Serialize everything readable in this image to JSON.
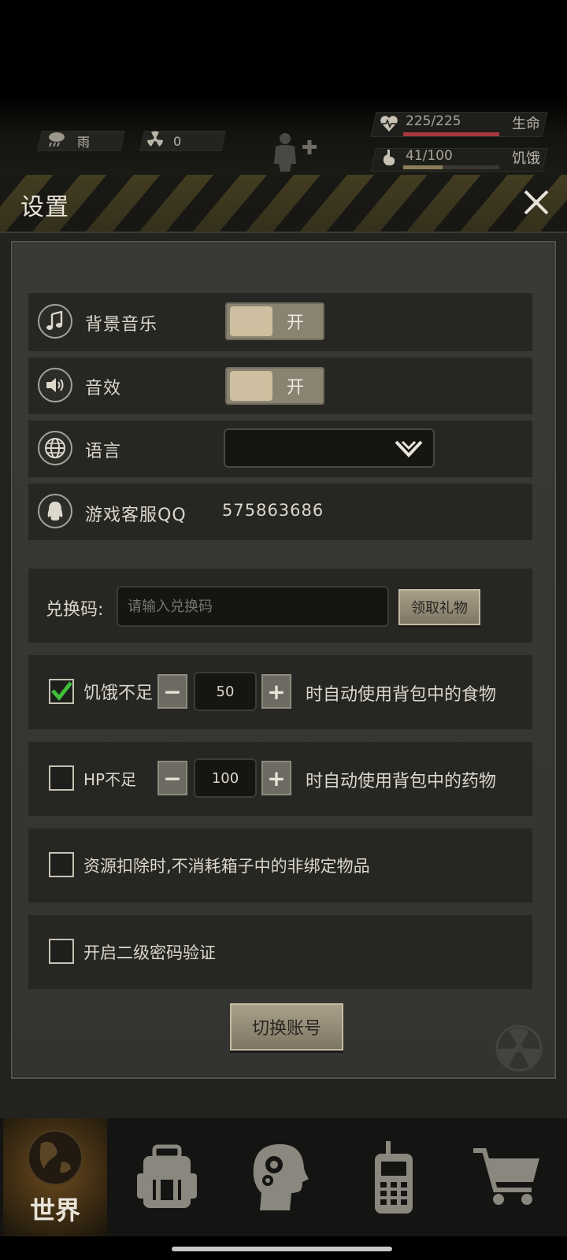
{
  "hud": {
    "weather_label": "雨",
    "weather_icon": "rain-cloud-icon",
    "radiation_value": "0",
    "radiation_icon": "radiation-icon",
    "health_text": "225/225",
    "health_label": "生命",
    "health_fraction": 1.0,
    "hunger_text": "41/100",
    "hunger_label": "饥饿",
    "hunger_fraction": 0.41,
    "colors": {
      "health_bar": "#a8383a",
      "hunger_bar": "#8a7e5a"
    }
  },
  "panel": {
    "title": "设置",
    "close_icon": "close-icon"
  },
  "settings": {
    "bgm_label": "背景音乐",
    "bgm_toggle": "开",
    "sfx_label": "音效",
    "sfx_toggle": "开",
    "language_label": "语言",
    "language_value": "",
    "support_label": "游戏客服QQ",
    "support_qq": "575863686"
  },
  "redeem": {
    "label": "兑换码:",
    "placeholder": "请输入兑换码",
    "button": "领取礼物"
  },
  "auto_food": {
    "checked": true,
    "label": "饥饿不足",
    "value": "50",
    "suffix": "时自动使用背包中的食物"
  },
  "auto_medicine": {
    "checked": false,
    "label": "HP不足",
    "value": "100",
    "suffix": "时自动使用背包中的药物"
  },
  "options": {
    "no_consume_label": "资源扣除时,不消耗箱子中的非绑定物品",
    "second_password_label": "开启二级密码验证"
  },
  "switch_account": "切换账号",
  "bottom_nav": {
    "world_label": "世界",
    "items": [
      "world-globe-icon",
      "backpack-icon",
      "skills-head-icon",
      "radio-icon",
      "shop-cart-icon"
    ]
  }
}
